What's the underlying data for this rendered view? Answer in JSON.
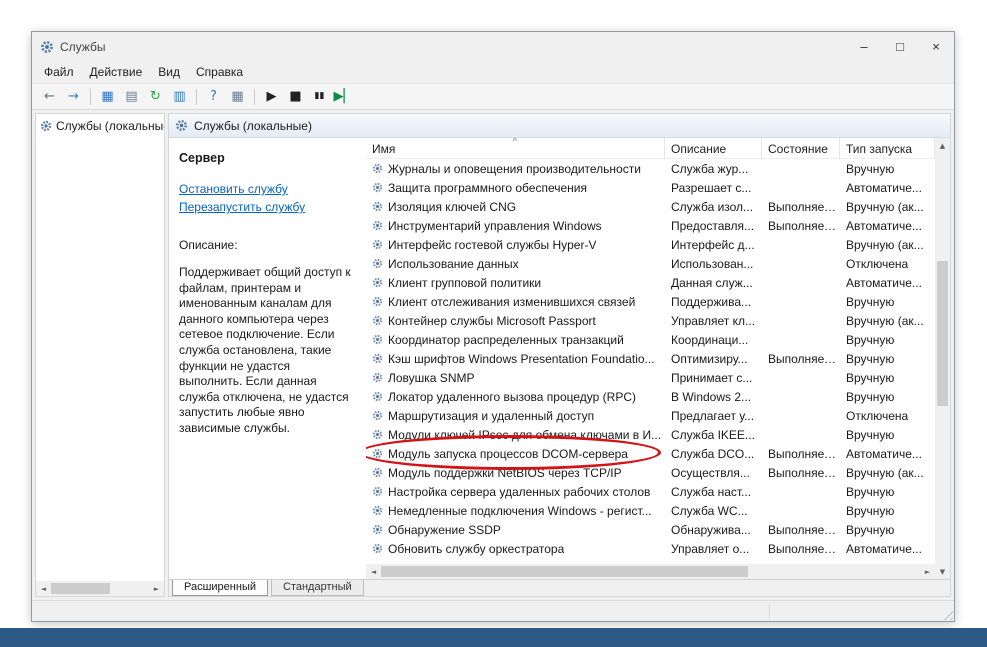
{
  "window": {
    "title": "Службы",
    "caption": {
      "minimize": "–",
      "maximize": "□",
      "close": "×"
    }
  },
  "menu": {
    "items": [
      "Файл",
      "Действие",
      "Вид",
      "Справка"
    ]
  },
  "toolbar": {
    "buttons": [
      {
        "name": "back",
        "glyph": "←",
        "color": "#5a6f8a"
      },
      {
        "name": "forward",
        "glyph": "→",
        "color": "#2f7fd0"
      },
      {
        "type": "separator"
      },
      {
        "name": "show-console-tree",
        "glyph": "▦",
        "color": "#2e75c8"
      },
      {
        "name": "properties",
        "glyph": "▤",
        "color": "#6b7c93"
      },
      {
        "name": "refresh",
        "glyph": "↻",
        "color": "#2f9e44"
      },
      {
        "name": "export-list",
        "glyph": "▥",
        "color": "#2e75c8"
      },
      {
        "type": "separator"
      },
      {
        "name": "help",
        "glyph": "?",
        "color": "#2e75c8"
      },
      {
        "name": "list-view",
        "glyph": "▦",
        "color": "#6b7c93"
      },
      {
        "type": "separator"
      },
      {
        "name": "start-service",
        "glyph": "▶",
        "color": "#222222"
      },
      {
        "name": "stop-service",
        "glyph": "■",
        "color": "#222222"
      },
      {
        "name": "pause-service",
        "glyph": "▮▮",
        "color": "#222222"
      },
      {
        "name": "restart-service",
        "glyph": "▶▏",
        "color": "#0c8a44"
      }
    ]
  },
  "tree": {
    "root_label": "Службы (локальные)"
  },
  "content": {
    "header_label": "Службы (локальные)",
    "panel": {
      "selected_service": "Сервер",
      "stop_link": "Остановить службу",
      "restart_link": "Перезапустить службу",
      "description_label": "Описание:",
      "description_text": "Поддерживает общий доступ к файлам, принтерам и именованным каналам для данного компьютера через сетевое подключение. Если служба остановлена, такие функции не удастся выполнить. Если данная служба отключена, не удастся запустить любые явно зависимые службы."
    }
  },
  "table": {
    "columns": [
      "Имя",
      "Описание",
      "Состояние",
      "Тип запуска"
    ],
    "sort_indicator": "^",
    "highlight_index": 15,
    "rows": [
      {
        "name": "Журналы и оповещения производительности",
        "description": "Служба жур...",
        "status": "",
        "startup": "Вручную"
      },
      {
        "name": "Защита программного обеспечения",
        "description": "Разрешает с...",
        "status": "",
        "startup": "Автоматиче..."
      },
      {
        "name": "Изоляция ключей CNG",
        "description": "Служба изол...",
        "status": "Выполняется",
        "startup": "Вручную (ак..."
      },
      {
        "name": "Инструментарий управления Windows",
        "description": "Предоставля...",
        "status": "Выполняется",
        "startup": "Автоматиче..."
      },
      {
        "name": "Интерфейс гостевой службы Hyper-V",
        "description": "Интерфейс д...",
        "status": "",
        "startup": "Вручную (ак..."
      },
      {
        "name": "Использование данных",
        "description": "Использован...",
        "status": "",
        "startup": "Отключена"
      },
      {
        "name": "Клиент групповой политики",
        "description": "Данная служ...",
        "status": "",
        "startup": "Автоматиче..."
      },
      {
        "name": "Клиент отслеживания изменившихся связей",
        "description": "Поддержива...",
        "status": "",
        "startup": "Вручную"
      },
      {
        "name": "Контейнер службы Microsoft Passport",
        "description": "Управляет кл...",
        "status": "",
        "startup": "Вручную (ак..."
      },
      {
        "name": "Координатор распределенных транзакций",
        "description": "Координаци...",
        "status": "",
        "startup": "Вручную"
      },
      {
        "name": "Кэш шрифтов Windows Presentation Foundatio...",
        "description": "Оптимизиру...",
        "status": "Выполняется",
        "startup": "Вручную"
      },
      {
        "name": "Ловушка SNMP",
        "description": "Принимает с...",
        "status": "",
        "startup": "Вручную"
      },
      {
        "name": "Локатор удаленного вызова процедур (RPC)",
        "description": "В Windows 2...",
        "status": "",
        "startup": "Вручную"
      },
      {
        "name": "Маршрутизация и удаленный доступ",
        "description": "Предлагает у...",
        "status": "",
        "startup": "Отключена"
      },
      {
        "name": "Модули ключей IPsec для обмена ключами в И...",
        "description": "Служба IKEE...",
        "status": "",
        "startup": "Вручную"
      },
      {
        "name": "Модуль запуска процессов DCOM-сервера",
        "description": "Служба DCO...",
        "status": "Выполняется",
        "startup": "Автоматиче..."
      },
      {
        "name": "Модуль поддержки NetBIOS через TCP/IP",
        "description": "Осуществля...",
        "status": "Выполняется",
        "startup": "Вручную (ак..."
      },
      {
        "name": "Настройка сервера удаленных рабочих столов",
        "description": "Служба наст...",
        "status": "",
        "startup": "Вручную"
      },
      {
        "name": "Немедленные подключения Windows - регист...",
        "description": "Служба WC...",
        "status": "",
        "startup": "Вручную"
      },
      {
        "name": "Обнаружение SSDP",
        "description": "Обнаружива...",
        "status": "Выполняется",
        "startup": "Вручную"
      },
      {
        "name": "Обновить службу оркестратора",
        "description": "Управляет о...",
        "status": "Выполняется",
        "startup": "Автоматиче..."
      }
    ]
  },
  "tabs": {
    "extended": "Расширенный",
    "standard": "Стандартный"
  },
  "icons": {
    "scroll_up": "▲",
    "scroll_down": "▼",
    "scroll_left": "◄",
    "scroll_right": "►"
  },
  "colors": {
    "highlight": "#d21417",
    "link": "#0563c1"
  }
}
